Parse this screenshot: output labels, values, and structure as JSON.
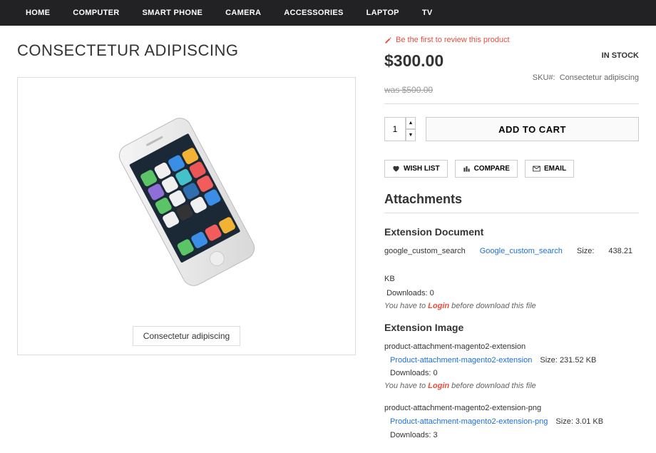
{
  "nav": [
    "HOME",
    "COMPUTER",
    "SMART PHONE",
    "CAMERA",
    "ACCESSORIES",
    "LAPTOP",
    "TV"
  ],
  "title": "CONSECTETUR ADIPISCING",
  "caption": "Consectetur adipiscing",
  "review": "Be the first to review this product",
  "price": "$300.00",
  "stock": "IN STOCK",
  "sku_label": "SKU#:",
  "sku_value": "Consectetur adipiscing",
  "old_price": "was $500.00",
  "qty": "1",
  "addcart": "ADD TO CART",
  "wishlist": "WISH LIST",
  "compare": "COMPARE",
  "email": "EMAIL",
  "attachments_h": "Attachments",
  "ext_doc_h": "Extension Document",
  "doc1": {
    "name": "google_custom_search",
    "link": "Google_custom_search",
    "size_label": "Size:",
    "size": "438.21",
    "size_unit": "KB",
    "dl_label": "Downloads:",
    "downloads": "0"
  },
  "login_note_pre": "You have to ",
  "login_word": "Login",
  "login_note_post": " before download this file",
  "ext_img_h": "Extension Image",
  "img1": {
    "name": "product-attachment-magento2-extension",
    "link": "Product-attachment-magento2-extension",
    "size_label": "Size:",
    "size": "231.52 KB",
    "dl_label": "Downloads:",
    "downloads": "0"
  },
  "img2": {
    "name": "product-attachment-magento2-extension-png",
    "link": "Product-attachment-magento2-extension-png",
    "size_label": "Size:",
    "size": "3.01 KB",
    "dl_label": "Downloads:",
    "downloads": "3"
  }
}
